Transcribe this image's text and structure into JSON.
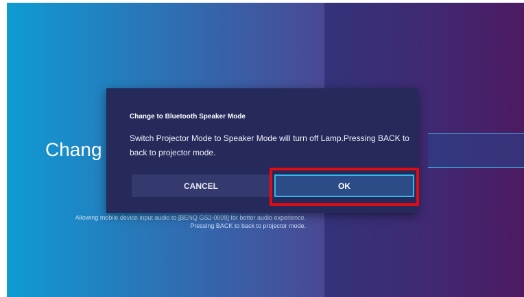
{
  "background": {
    "title": "Chang",
    "description_line1": "Allowing mobile device input audio to [BENQ GS2-0009] for better audio experience.",
    "description_line2": "Pressing BACK to back to projector mode."
  },
  "dialog": {
    "title": "Change to Bluetooth Speaker Mode",
    "message": "Switch Projector Mode to Speaker Mode will turn off Lamp.Pressing BACK to back to projector mode.",
    "cancel_label": "CANCEL",
    "ok_label": "OK"
  },
  "colors": {
    "dialog_bg": "#252a5b",
    "focus_border": "#34b9ec",
    "annotation_red": "#e10c12"
  }
}
